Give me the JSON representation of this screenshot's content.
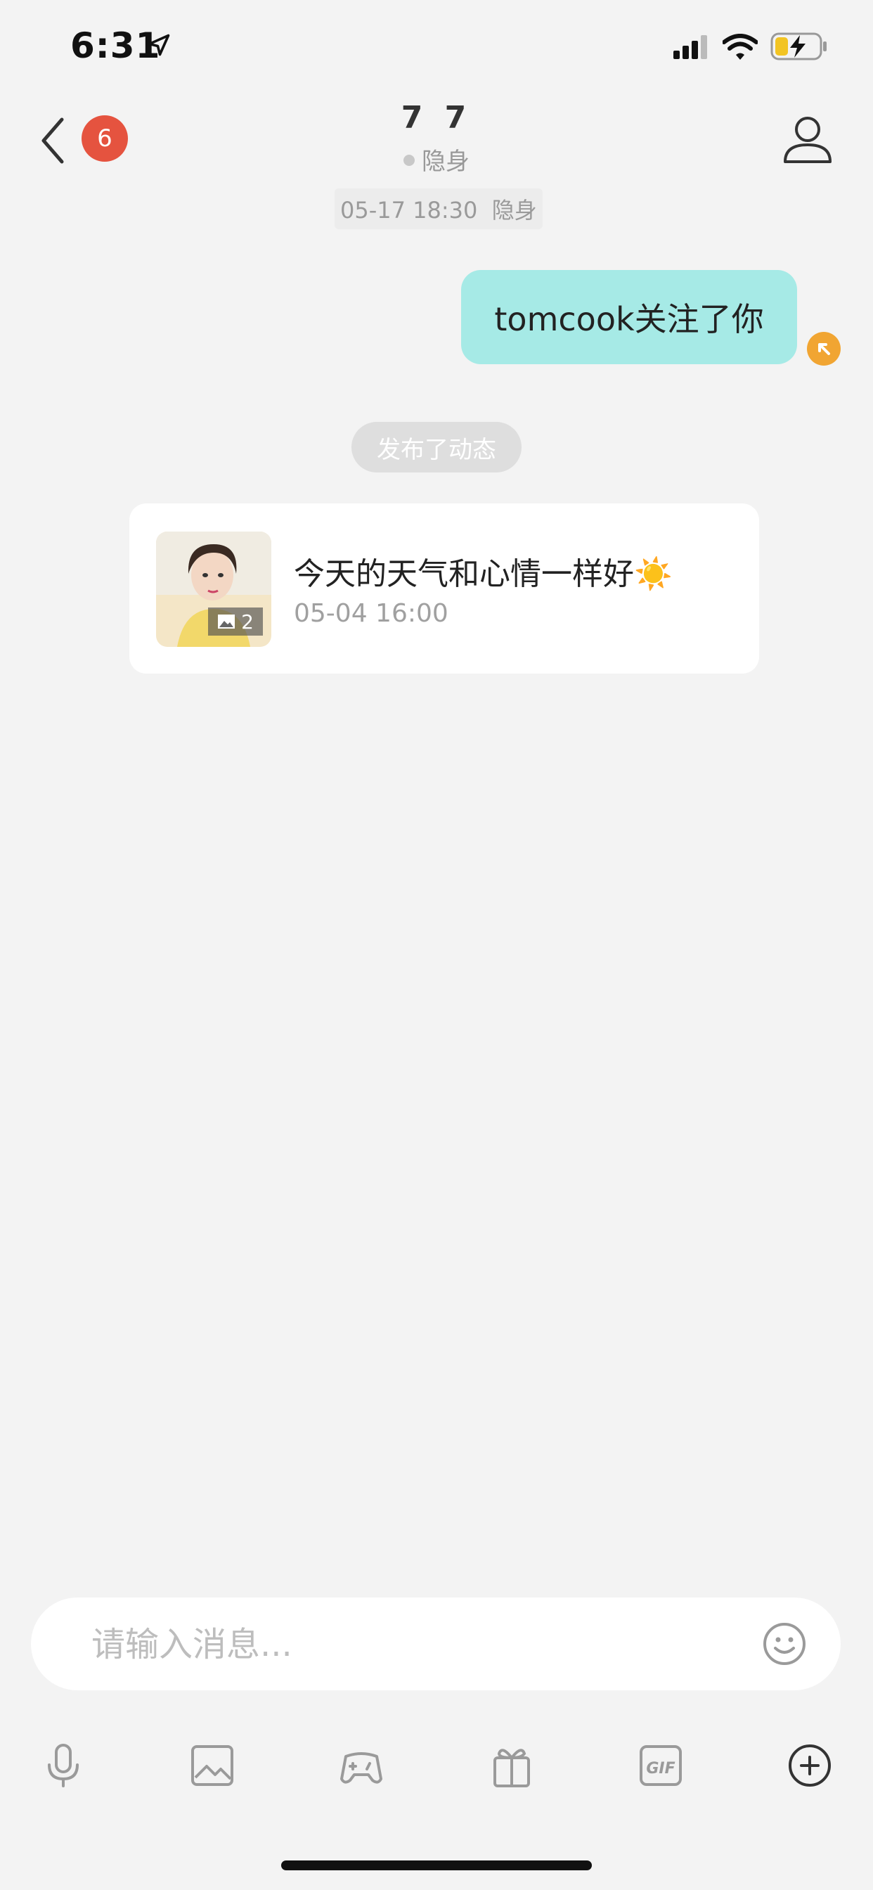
{
  "status_bar": {
    "time": "6:31",
    "icons": [
      "location-arrow-icon",
      "cellular-signal-icon",
      "wifi-icon",
      "battery-charging-icon"
    ]
  },
  "nav": {
    "unread_count": "6",
    "contact_name": "7 7",
    "contact_status": "隐身",
    "icons": [
      "chevron-left-icon",
      "user-profile-icon"
    ]
  },
  "messages": {
    "timestamp": "05-17 18:30  隐身",
    "sent_bubble": "tomcook关注了你",
    "system_notice": "发布了动态",
    "moment": {
      "text": "今天的天气和心情一样好☀️",
      "date": "05-04 16:00",
      "photo_count": "2"
    }
  },
  "composer": {
    "placeholder": "请输入消息..."
  },
  "toolbar": {
    "items": [
      "microphone-icon",
      "image-icon",
      "game-controller-icon",
      "gift-icon",
      "gif-icon",
      "add-circle-icon"
    ]
  },
  "colors": {
    "background": "#f3f3f3",
    "bubble": "#a6eae6",
    "badge": "#e5533f",
    "resend": "#f1a532"
  }
}
